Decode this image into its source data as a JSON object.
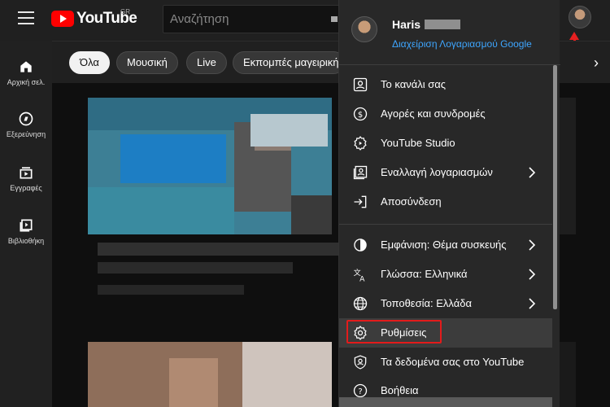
{
  "header": {
    "logo_text": "YouTube",
    "region": "GR",
    "search_placeholder": "Αναζήτηση"
  },
  "sidebar": {
    "items": [
      {
        "label": "Αρχική σελ.",
        "icon": "home-icon"
      },
      {
        "label": "Εξερεύνηση",
        "icon": "compass-icon"
      },
      {
        "label": "Εγγραφές",
        "icon": "subscriptions-icon"
      },
      {
        "label": "Βιβλιοθήκη",
        "icon": "library-icon"
      }
    ]
  },
  "chips": [
    {
      "label": "Όλα",
      "active": true
    },
    {
      "label": "Μουσική",
      "active": false
    },
    {
      "label": "Live",
      "active": false
    },
    {
      "label": "Εκπομπές μαγειρικής",
      "active": false
    }
  ],
  "account_menu": {
    "user_name": "Haris",
    "manage_account": "Διαχείριση Λογαριασμού Google",
    "items": [
      {
        "label": "Το κανάλι σας",
        "icon": "person-icon",
        "has_submenu": false
      },
      {
        "label": "Αγορές και συνδρομές",
        "icon": "dollar-circle-icon",
        "has_submenu": false
      },
      {
        "label": "YouTube Studio",
        "icon": "studio-gear-icon",
        "has_submenu": false
      },
      {
        "label": "Εναλλαγή λογαριασμών",
        "icon": "switch-account-icon",
        "has_submenu": true
      },
      {
        "label": "Αποσύνδεση",
        "icon": "sign-out-icon",
        "has_submenu": false
      },
      {
        "label": "Εμφάνιση: Θέμα συσκευής",
        "icon": "appearance-icon",
        "has_submenu": true
      },
      {
        "label": "Γλώσσα: Ελληνικά",
        "icon": "translate-icon",
        "has_submenu": true
      },
      {
        "label": "Τοποθεσία: Ελλάδα",
        "icon": "globe-icon",
        "has_submenu": true
      },
      {
        "label": "Ρυθμίσεις",
        "icon": "settings-icon",
        "has_submenu": false,
        "highlighted": true
      },
      {
        "label": "Τα δεδομένα σας στο YouTube",
        "icon": "shield-person-icon",
        "has_submenu": false
      },
      {
        "label": "Βοήθεια",
        "icon": "help-icon",
        "has_submenu": false
      }
    ]
  },
  "colors": {
    "accent_red": "#ff0000",
    "link_blue": "#3ea6ff",
    "highlight_box": "#e31b1b"
  }
}
